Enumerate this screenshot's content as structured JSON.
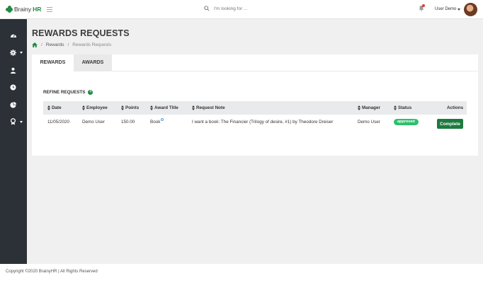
{
  "header": {
    "brand_prefix": "Brainy",
    "brand_suffix": "HR",
    "search_placeholder": "I'm looking for ...",
    "user_name": "User Demo"
  },
  "sidebar": {
    "items": [
      {
        "icon": "dashboard-icon",
        "has_caret": false
      },
      {
        "icon": "gear-icon",
        "has_caret": true
      },
      {
        "icon": "user-icon",
        "has_caret": false
      },
      {
        "icon": "clock-icon",
        "has_caret": false
      },
      {
        "icon": "pie-chart-icon",
        "has_caret": false
      },
      {
        "icon": "award-icon",
        "has_caret": true
      }
    ]
  },
  "page": {
    "title": "REWARDS REQUESTS",
    "breadcrumb": {
      "home_icon": "home-icon",
      "parent": "Rewards",
      "current": "Rewards Requests",
      "separator": "/"
    }
  },
  "tabs": [
    {
      "label": "REWARDS",
      "active": true
    },
    {
      "label": "AWARDS",
      "active": false
    }
  ],
  "refine": {
    "label": "REFINE REQUESTS"
  },
  "table": {
    "columns": {
      "date": "Date",
      "employee": "Employee",
      "points": "Points",
      "award_title": "Award Title",
      "request_note": "Request Note",
      "manager": "Manager",
      "status": "Status",
      "actions": "Actions"
    },
    "rows": [
      {
        "date": "11/05/2020",
        "employee": "Demo User",
        "points": "150.00",
        "award_title": "Book",
        "request_note": "I want a book: The Financier (Trilogy of desire, #1) by Theodore Dreiser",
        "manager": "Demo User",
        "status": "approved",
        "action": "Complete"
      }
    ]
  },
  "colors": {
    "brand_green": "#1f8a45",
    "sidebar_bg": "#2c3137",
    "status_approved": "#2ebf6f",
    "complete_button": "#1d7a3f"
  },
  "footer": {
    "text": "Copyright ©2020 BrainyHR | All Rights Reserved"
  }
}
